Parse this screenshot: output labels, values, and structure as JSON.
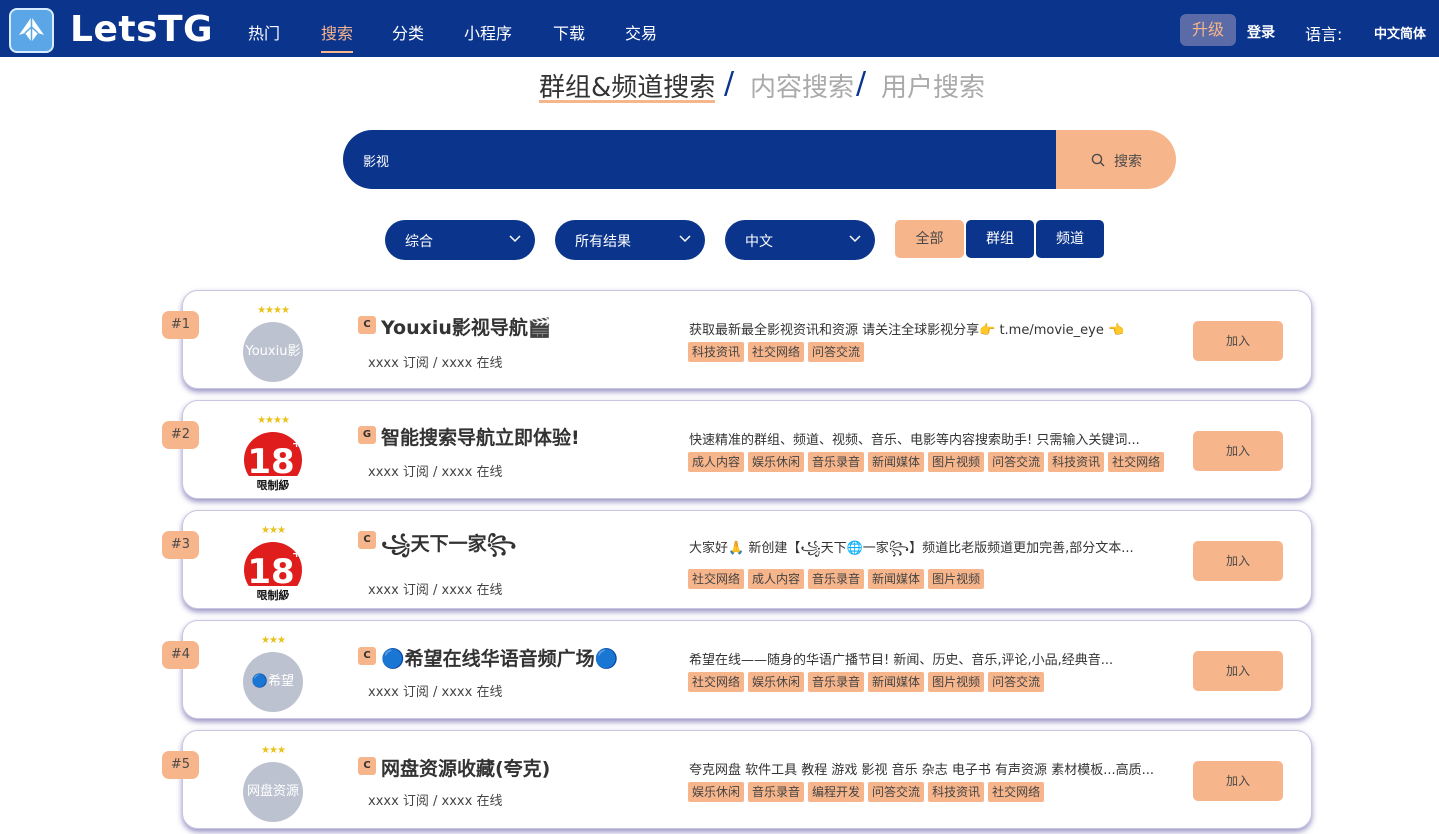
{
  "nav": {
    "brand": "LetsTG",
    "items": [
      {
        "label": "热门"
      },
      {
        "label": "搜索"
      },
      {
        "label": "分类"
      },
      {
        "label": "小程序"
      },
      {
        "label": "下载"
      },
      {
        "label": "交易"
      }
    ],
    "active_item": "搜索",
    "upgrade": "升级",
    "login": "登录",
    "language_label": "语言:",
    "language_value": "中文简体"
  },
  "search_tabs": [
    {
      "label": "群组&频道搜索"
    },
    {
      "label": "内容搜索"
    },
    {
      "label": "用户搜索"
    }
  ],
  "search_tabs_separator": "/",
  "active_search_tab": "群组&频道搜索",
  "search": {
    "value": "影视",
    "button_label": "搜索",
    "icon": "search-icon"
  },
  "filters": {
    "sort": "综合",
    "result_range": "所有结果",
    "language": "中文",
    "type_tabs": [
      {
        "label": "全部"
      },
      {
        "label": "群组"
      },
      {
        "label": "频道"
      }
    ],
    "active_type": "全部"
  },
  "results": [
    {
      "rank": "#1",
      "stars": "★★★★",
      "avatar_text": "Youxiu影",
      "avatar_kind": "placeholder",
      "type": "C",
      "title": "Youxiu影视导航🎬",
      "stats": "xxxx 订阅 / xxxx 在线",
      "description": "获取最新最全影视资讯和资源 请关注全球影视分享👉 t.me/movie_eye 👈",
      "tags": [
        "科技资讯",
        "社交网络",
        "问答交流"
      ],
      "join": "加入"
    },
    {
      "rank": "#2",
      "stars": "★★★★",
      "avatar_text": "18",
      "avatar_caption": "限制級",
      "avatar_kind": "adult",
      "type": "G",
      "title": "智能搜索导航立即体验!",
      "stats": "xxxx 订阅 / xxxx 在线",
      "description": "快速精准的群组、频道、视频、音乐、电影等内容搜索助手! 只需输入关键词...",
      "tags": [
        "成人内容",
        "娱乐休闲",
        "音乐录音",
        "新闻媒体",
        "图片视频",
        "问答交流",
        "科技资讯",
        "社交网络"
      ],
      "join": "加入"
    },
    {
      "rank": "#3",
      "stars": "★★★",
      "avatar_text": "18",
      "avatar_caption": "限制級",
      "avatar_kind": "adult",
      "type": "C",
      "title": "꧁天下一家꧂",
      "stats": "xxxx 订阅 / xxxx 在线",
      "description": "大家好🙏 新创建【꧁天下🌐一家꧂】频道比老版频道更加完善,部分文本...",
      "tags": [
        "社交网络",
        "成人内容",
        "音乐录音",
        "新闻媒体",
        "图片视频"
      ],
      "join": "加入"
    },
    {
      "rank": "#4",
      "stars": "★★★",
      "avatar_text": "🔵希望",
      "avatar_kind": "placeholder",
      "type": "C",
      "title": "🔵希望在线华语音频广场🔵",
      "stats": "xxxx 订阅 / xxxx 在线",
      "description": "希望在线——随身的华语广播节目! 新闻、历史、音乐,评论,小品,经典音...",
      "tags": [
        "社交网络",
        "娱乐休闲",
        "音乐录音",
        "新闻媒体",
        "图片视频",
        "问答交流"
      ],
      "join": "加入"
    },
    {
      "rank": "#5",
      "stars": "★★★",
      "avatar_text": "网盘资源",
      "avatar_kind": "placeholder",
      "type": "C",
      "title": "网盘资源收藏(夸克)",
      "stats": "xxxx 订阅 / xxxx 在线",
      "description": "夸克网盘 软件工具 教程 游戏 影视 音乐 杂志 电子书 有声资源 素材模板...高质...",
      "tags": [
        "娱乐休闲",
        "音乐录音",
        "编程开发",
        "问答交流",
        "科技资讯",
        "社交网络"
      ],
      "join": "加入"
    }
  ],
  "colors": {
    "primary": "#0b348c",
    "accent": "#f7b58b",
    "star": "#e8c21b",
    "avatar_placeholder": "#bcc2cf",
    "adult_red": "#e01d1d"
  }
}
